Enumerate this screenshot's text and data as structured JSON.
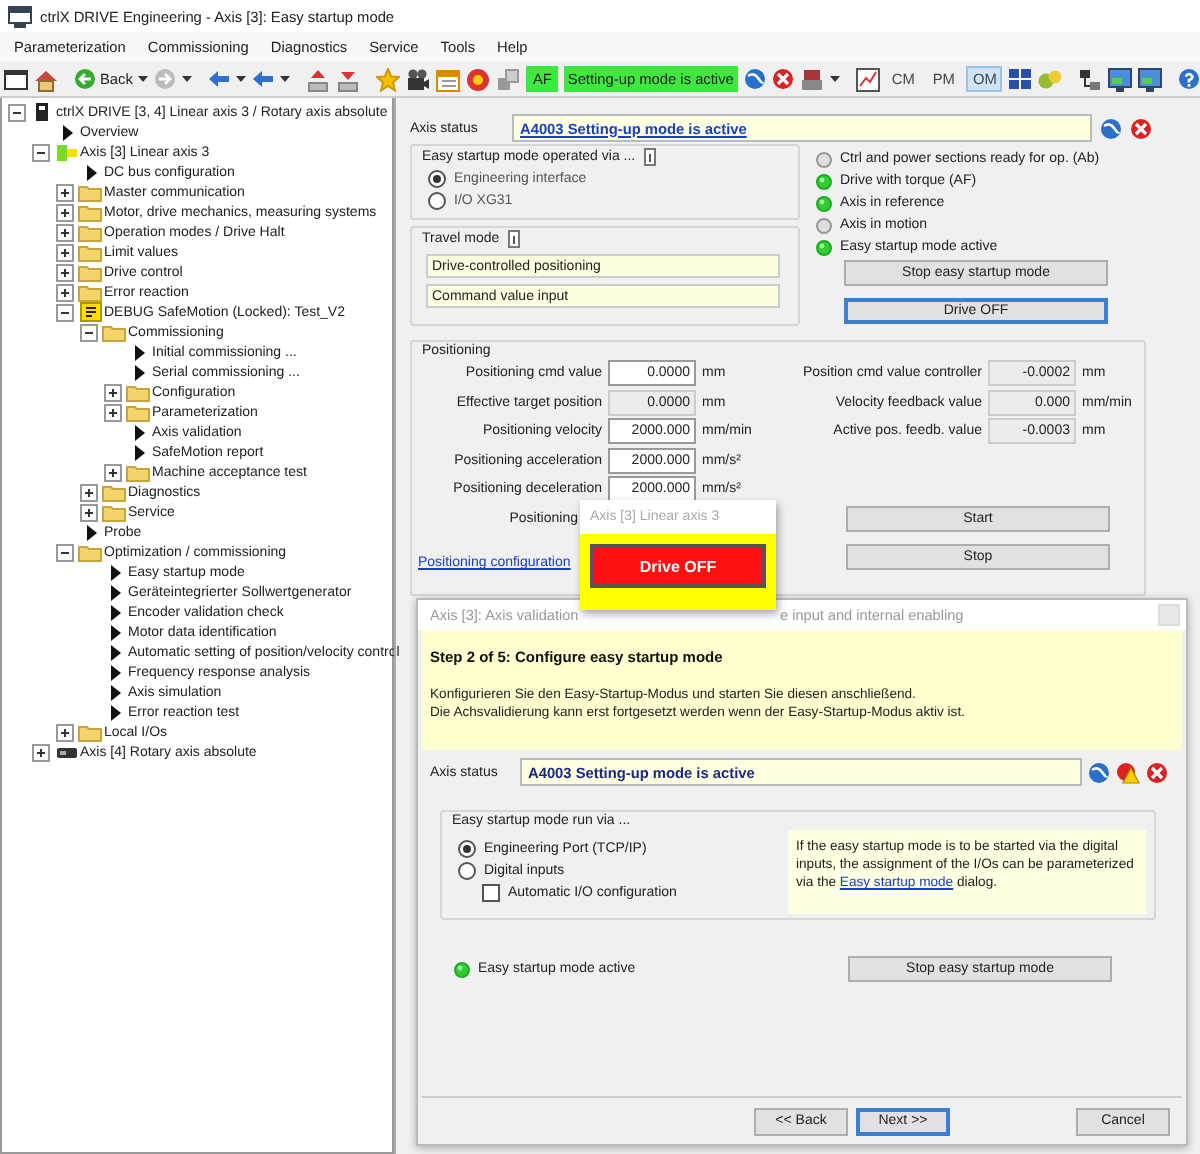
{
  "window": {
    "title": "ctrlX DRIVE Engineering - Axis [3]: Easy startup mode"
  },
  "menu": [
    "Parameterization",
    "Commissioning",
    "Diagnostics",
    "Service",
    "Tools",
    "Help"
  ],
  "toolbar": {
    "back_label": "Back",
    "state_badge": "AF",
    "status_badge": "Setting-up mode is active",
    "modes": [
      {
        "label": "CM",
        "selected": false
      },
      {
        "label": "PM",
        "selected": false
      },
      {
        "label": "OM",
        "selected": true
      }
    ]
  },
  "tree": [
    {
      "label": "ctrlX DRIVE [3, 4] Linear axis 3 / Rotary axis absolute",
      "kind": "drive",
      "expanded": true,
      "children": [
        {
          "label": "Overview",
          "kind": "page"
        },
        {
          "label": "Axis [3] Linear axis 3",
          "kind": "axis",
          "active": true,
          "expanded": true,
          "children": [
            {
              "label": "DC bus configuration",
              "kind": "page"
            },
            {
              "label": "Master communication",
              "kind": "folder",
              "expanded": false
            },
            {
              "label": "Motor, drive mechanics, measuring systems",
              "kind": "folder",
              "expanded": false
            },
            {
              "label": "Operation modes / Drive Halt",
              "kind": "folder",
              "expanded": false
            },
            {
              "label": "Limit values",
              "kind": "folder",
              "expanded": false
            },
            {
              "label": "Drive control",
              "kind": "folder",
              "expanded": false
            },
            {
              "label": "Error reaction",
              "kind": "folder",
              "expanded": false
            },
            {
              "label": "DEBUG SafeMotion (Locked): Test_V2",
              "kind": "safety",
              "expanded": true,
              "children": [
                {
                  "label": "Commissioning",
                  "kind": "folder",
                  "expanded": true,
                  "children": [
                    {
                      "label": "Initial commissioning ...",
                      "kind": "page"
                    },
                    {
                      "label": "Serial commissioning ...",
                      "kind": "page"
                    },
                    {
                      "label": "Configuration",
                      "kind": "folder",
                      "expanded": false
                    },
                    {
                      "label": "Parameterization",
                      "kind": "folder",
                      "expanded": false
                    },
                    {
                      "label": "Axis validation",
                      "kind": "page"
                    },
                    {
                      "label": "SafeMotion report",
                      "kind": "page"
                    },
                    {
                      "label": "Machine acceptance test",
                      "kind": "folder",
                      "expanded": false
                    }
                  ]
                },
                {
                  "label": "Diagnostics",
                  "kind": "folder",
                  "expanded": false
                },
                {
                  "label": "Service",
                  "kind": "folder",
                  "expanded": false
                }
              ]
            },
            {
              "label": "Probe",
              "kind": "page"
            },
            {
              "label": "Optimization / commissioning",
              "kind": "folder",
              "expanded": true,
              "children": [
                {
                  "label": "Easy startup mode",
                  "kind": "page"
                },
                {
                  "label": "Geräteintegrierter Sollwertgenerator",
                  "kind": "page"
                },
                {
                  "label": "Encoder validation check",
                  "kind": "page"
                },
                {
                  "label": "Motor data identification",
                  "kind": "page"
                },
                {
                  "label": "Automatic setting of position/velocity control",
                  "kind": "page"
                },
                {
                  "label": "Frequency response analysis",
                  "kind": "page"
                },
                {
                  "label": "Axis simulation",
                  "kind": "page"
                },
                {
                  "label": "Error reaction test",
                  "kind": "page"
                }
              ]
            },
            {
              "label": "Local I/Os",
              "kind": "folder",
              "expanded": false
            }
          ]
        },
        {
          "label": "Axis [4] Rotary axis absolute",
          "kind": "axis",
          "active": false,
          "expanded": false
        }
      ]
    }
  ],
  "axis_status": {
    "label": "Axis status",
    "value": "A4003 Setting-up mode is active",
    "kind": "link"
  },
  "operated_via": {
    "title": "Easy startup mode operated via ...",
    "options": [
      {
        "label": "Engineering interface",
        "selected": true
      },
      {
        "label": "I/O XG31",
        "selected": false
      }
    ]
  },
  "travel_mode": {
    "title": "Travel mode",
    "fields": [
      "Drive-controlled positioning",
      "Command value input"
    ]
  },
  "indicators": [
    {
      "label": "Ctrl and power sections ready for op. (Ab)",
      "on": false
    },
    {
      "label": "Drive with torque (AF)",
      "on": true
    },
    {
      "label": "Axis in reference",
      "on": true
    },
    {
      "label": "Axis in motion",
      "on": false
    },
    {
      "label": "Easy startup mode active",
      "on": true
    }
  ],
  "mode_buttons": [
    {
      "label": "Stop easy startup mode",
      "focused": false
    },
    {
      "label": "Drive OFF",
      "focused": true
    }
  ],
  "positioning": {
    "title": "Positioning",
    "left_rows": [
      {
        "label": "Positioning cmd value",
        "value": "0.0000",
        "unit": "mm",
        "editable": true
      },
      {
        "label": "Effective target position",
        "value": "0.0000",
        "unit": "mm",
        "editable": false
      },
      {
        "label": "Positioning velocity",
        "value": "2000.000",
        "unit": "mm/min",
        "editable": true
      },
      {
        "label": "Positioning acceleration",
        "value": "2000.000",
        "unit": "mm/s²",
        "editable": true
      },
      {
        "label": "Positioning deceleration",
        "value": "2000.000",
        "unit": "mm/s²",
        "editable": true
      }
    ],
    "right_rows": [
      {
        "label": "Position cmd value controller",
        "value": "-0.0002",
        "unit": "mm",
        "editable": false
      },
      {
        "label": "Velocity feedback value",
        "value": "0.000",
        "unit": "mm/min",
        "editable": false
      },
      {
        "label": "Active pos. feedb. value",
        "value": "-0.0003",
        "unit": "mm",
        "editable": false
      }
    ],
    "mode_label": "Positioning",
    "buttons": [
      "Start",
      "Stop"
    ],
    "link": "Positioning configuration"
  },
  "popup": {
    "title": "Axis [3] Linear axis 3",
    "button": "Drive OFF"
  },
  "wizard": {
    "title_start": "Axis [3]: Axis validation",
    "title_end": "e input and internal enabling",
    "step": "Step 2 of 5: Configure easy startup mode",
    "description": [
      "Konfigurieren Sie den Easy-Startup-Modus und starten Sie diesen anschließend.",
      "Die Achsvalidierung kann erst fortgesetzt werden wenn der Easy-Startup-Modus aktiv ist."
    ],
    "axis_status": {
      "label": "Axis status",
      "value": "A4003 Setting-up mode is active",
      "kind": "text"
    },
    "run_via": {
      "title": "Easy startup mode run via ...",
      "options": [
        {
          "label": "Engineering Port (TCP/IP)",
          "selected": true
        },
        {
          "label": "Digital inputs",
          "selected": false
        }
      ],
      "checkbox": {
        "label": "Automatic I/O configuration",
        "checked": false
      }
    },
    "note": {
      "before": "If the easy startup mode is to be started via the digital inputs, the assignment of the I/Os can be parameterized via the ",
      "link": "Easy startup mode",
      "after": " dialog."
    },
    "indicator": {
      "label": "Easy startup mode active",
      "on": true
    },
    "stop_button": "Stop easy startup mode",
    "nav_buttons": [
      {
        "label": "<< Back",
        "focused": false
      },
      {
        "label": "Next >>",
        "focused": true
      },
      {
        "label": "Cancel",
        "focused": false
      }
    ]
  }
}
